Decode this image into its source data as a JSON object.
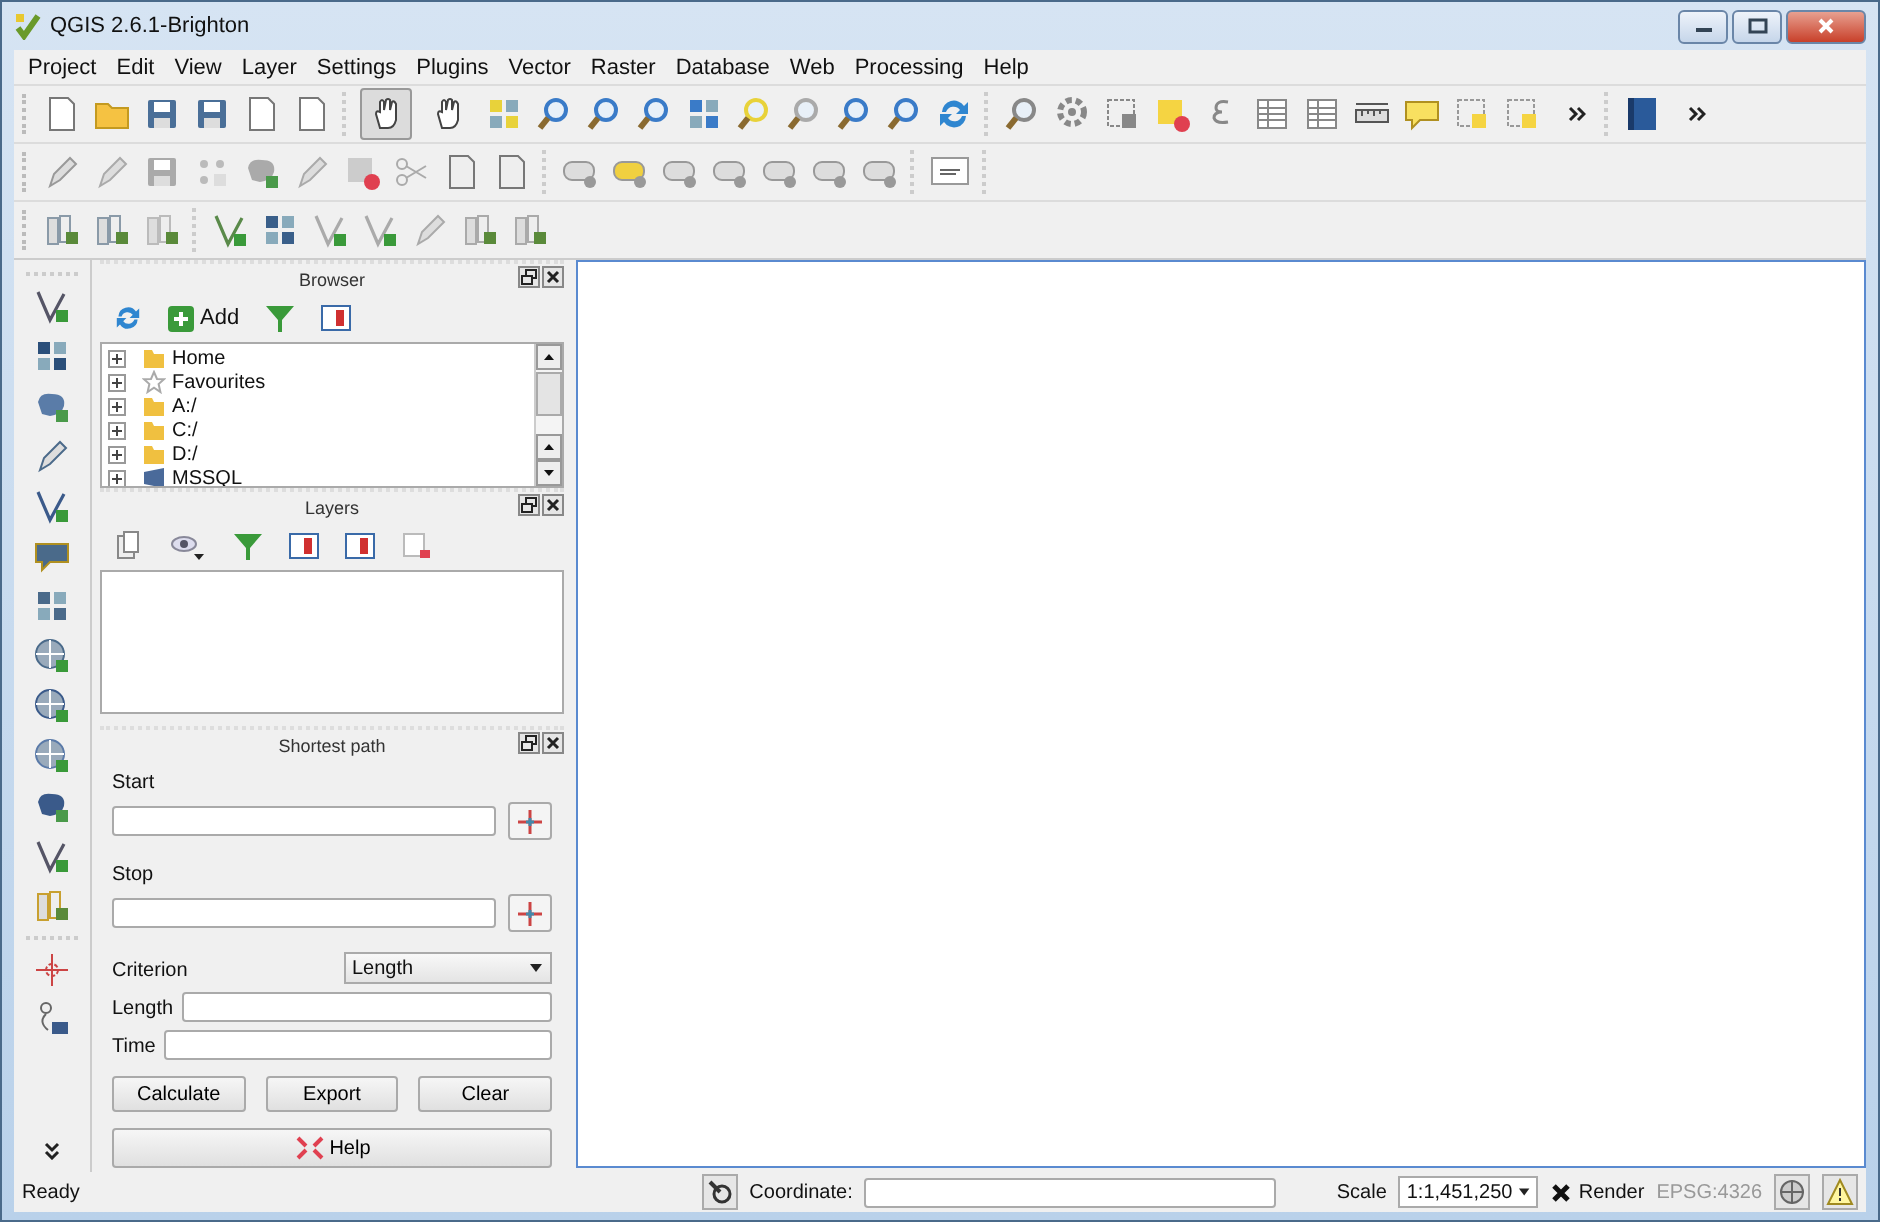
{
  "window": {
    "title": "QGIS 2.6.1-Brighton"
  },
  "menu": [
    "Project",
    "Edit",
    "View",
    "Layer",
    "Settings",
    "Plugins",
    "Vector",
    "Raster",
    "Database",
    "Web",
    "Processing",
    "Help"
  ],
  "map_navigation_tools": [
    {
      "selected": true
    },
    {
      "selected": false
    }
  ],
  "browser_panel": {
    "title": "Browser",
    "add_label": "Add",
    "items": [
      {
        "label": "Home",
        "expanded": false
      },
      {
        "label": "Favourites",
        "expanded": false
      },
      {
        "label": "A:/",
        "expanded": false
      },
      {
        "label": "C:/",
        "expanded": false
      },
      {
        "label": "D:/",
        "expanded": false
      },
      {
        "label": "MSSQL",
        "expanded": false
      }
    ]
  },
  "layers_panel": {
    "title": "Layers"
  },
  "shortest_path_panel": {
    "title": "Shortest path",
    "start_label": "Start",
    "stop_label": "Stop",
    "criterion_label": "Criterion",
    "criterion_value": "Length",
    "length_label": "Length",
    "time_label": "Time",
    "buttons": [
      "Calculate",
      "Export",
      "Clear"
    ],
    "help_label": "Help"
  },
  "status_bar": {
    "message": "Ready",
    "coordinate_label": "Coordinate:",
    "scale_label": "Scale",
    "scale_value": "1:1,451,250",
    "render": {
      "label": "Render",
      "checked": true
    },
    "crs": "EPSG:4326"
  }
}
